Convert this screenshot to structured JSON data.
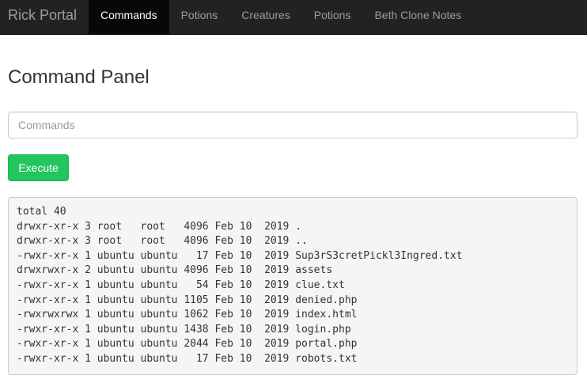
{
  "navbar": {
    "brand": "Rick Portal",
    "items": [
      {
        "label": "Commands",
        "active": true
      },
      {
        "label": "Potions",
        "active": false
      },
      {
        "label": "Creatures",
        "active": false
      },
      {
        "label": "Potions",
        "active": false
      },
      {
        "label": "Beth Clone Notes",
        "active": false
      }
    ]
  },
  "main": {
    "title": "Command Panel",
    "command_input": {
      "value": "",
      "placeholder": "Commands"
    },
    "execute_label": "Execute",
    "output_lines": [
      "total 40",
      "drwxr-xr-x 3 root   root   4096 Feb 10  2019 .",
      "drwxr-xr-x 3 root   root   4096 Feb 10  2019 ..",
      "-rwxr-xr-x 1 ubuntu ubuntu   17 Feb 10  2019 Sup3rS3cretPickl3Ingred.txt",
      "drwxrwxr-x 2 ubuntu ubuntu 4096 Feb 10  2019 assets",
      "-rwxr-xr-x 1 ubuntu ubuntu   54 Feb 10  2019 clue.txt",
      "-rwxr-xr-x 1 ubuntu ubuntu 1105 Feb 10  2019 denied.php",
      "-rwxrwxrwx 1 ubuntu ubuntu 1062 Feb 10  2019 index.html",
      "-rwxr-xr-x 1 ubuntu ubuntu 1438 Feb 10  2019 login.php",
      "-rwxr-xr-x 1 ubuntu ubuntu 2044 Feb 10  2019 portal.php",
      "-rwxr-xr-x 1 ubuntu ubuntu   17 Feb 10  2019 robots.txt"
    ]
  },
  "colors": {
    "navbar_bg": "#222222",
    "nav_active_bg": "#080808",
    "execute_button": "#22c55e",
    "output_bg": "#f5f5f5"
  }
}
